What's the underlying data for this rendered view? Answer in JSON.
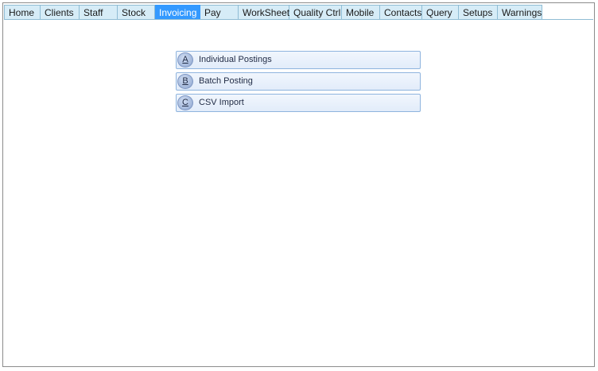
{
  "tabs": [
    {
      "label": "Home",
      "active": false
    },
    {
      "label": "Clients",
      "active": false
    },
    {
      "label": "Staff",
      "active": false
    },
    {
      "label": "Stock",
      "active": false
    },
    {
      "label": "Invoicing",
      "active": true
    },
    {
      "label": "Pay",
      "active": false
    },
    {
      "label": "WorkSheet",
      "active": false
    },
    {
      "label": "Quality Ctrl",
      "active": false
    },
    {
      "label": "Mobile",
      "active": false
    },
    {
      "label": "Contacts",
      "active": false
    },
    {
      "label": "Query",
      "active": false
    },
    {
      "label": "Setups",
      "active": false
    },
    {
      "label": "Warnings",
      "active": false
    }
  ],
  "menu": {
    "items": [
      {
        "key": "A",
        "label": "Individual Postings"
      },
      {
        "key": "B",
        "label": "Batch Posting"
      },
      {
        "key": "C",
        "label": "CSV Import"
      }
    ]
  },
  "colors": {
    "active_tab": "#3399ff",
    "inactive_tab": "#d6ecf7",
    "button_face": "#e6eefa",
    "button_border": "#8fb4de"
  }
}
